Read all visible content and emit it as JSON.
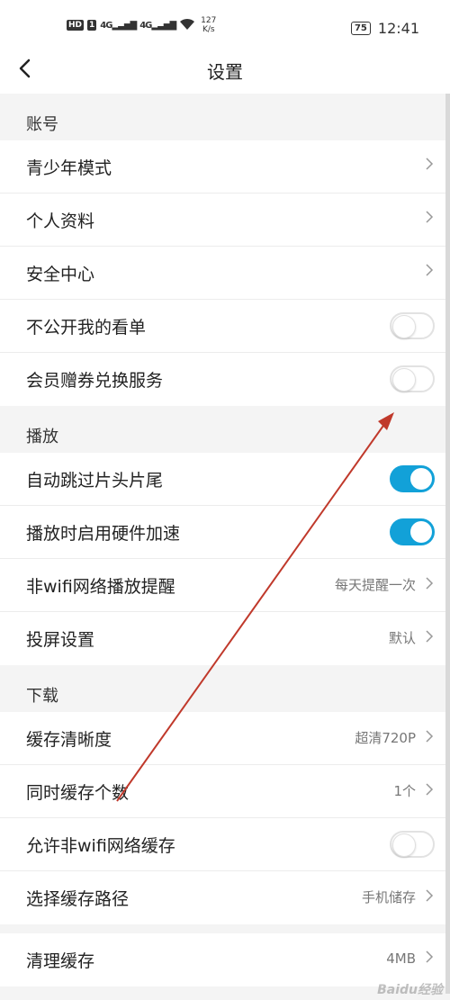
{
  "status_bar": {
    "hd": "HD",
    "sim": "1",
    "signal1": "4G",
    "signal2": "4G",
    "speed_value": "127",
    "speed_unit": "K/s",
    "battery": "75",
    "time": "12:41"
  },
  "nav": {
    "title": "设置"
  },
  "sections": {
    "account": {
      "header": "账号",
      "rows": [
        {
          "label": "青少年模式"
        },
        {
          "label": "个人资料"
        },
        {
          "label": "安全中心"
        },
        {
          "label": "不公开我的看单",
          "toggle": "off"
        },
        {
          "label": "会员赠券兑换服务",
          "toggle": "off"
        }
      ]
    },
    "playback": {
      "header": "播放",
      "rows": [
        {
          "label": "自动跳过片头片尾",
          "toggle": "on"
        },
        {
          "label": "播放时启用硬件加速",
          "toggle": "on"
        },
        {
          "label": "非wifi网络播放提醒",
          "value": "每天提醒一次"
        },
        {
          "label": "投屏设置",
          "value": "默认"
        }
      ]
    },
    "download": {
      "header": "下载",
      "rows": [
        {
          "label": "缓存清晰度",
          "value": "超清720P"
        },
        {
          "label": "同时缓存个数",
          "value": "1个"
        },
        {
          "label": "允许非wifi网络缓存",
          "toggle": "off"
        },
        {
          "label": "选择缓存路径",
          "value": "手机储存"
        }
      ]
    },
    "cache": {
      "rows": [
        {
          "label": "清理缓存",
          "value": "4MB"
        }
      ]
    }
  },
  "watermark": "Baidu经验",
  "colors": {
    "toggle_on": "#12a1d8",
    "annotation_arrow": "#c0392b"
  }
}
